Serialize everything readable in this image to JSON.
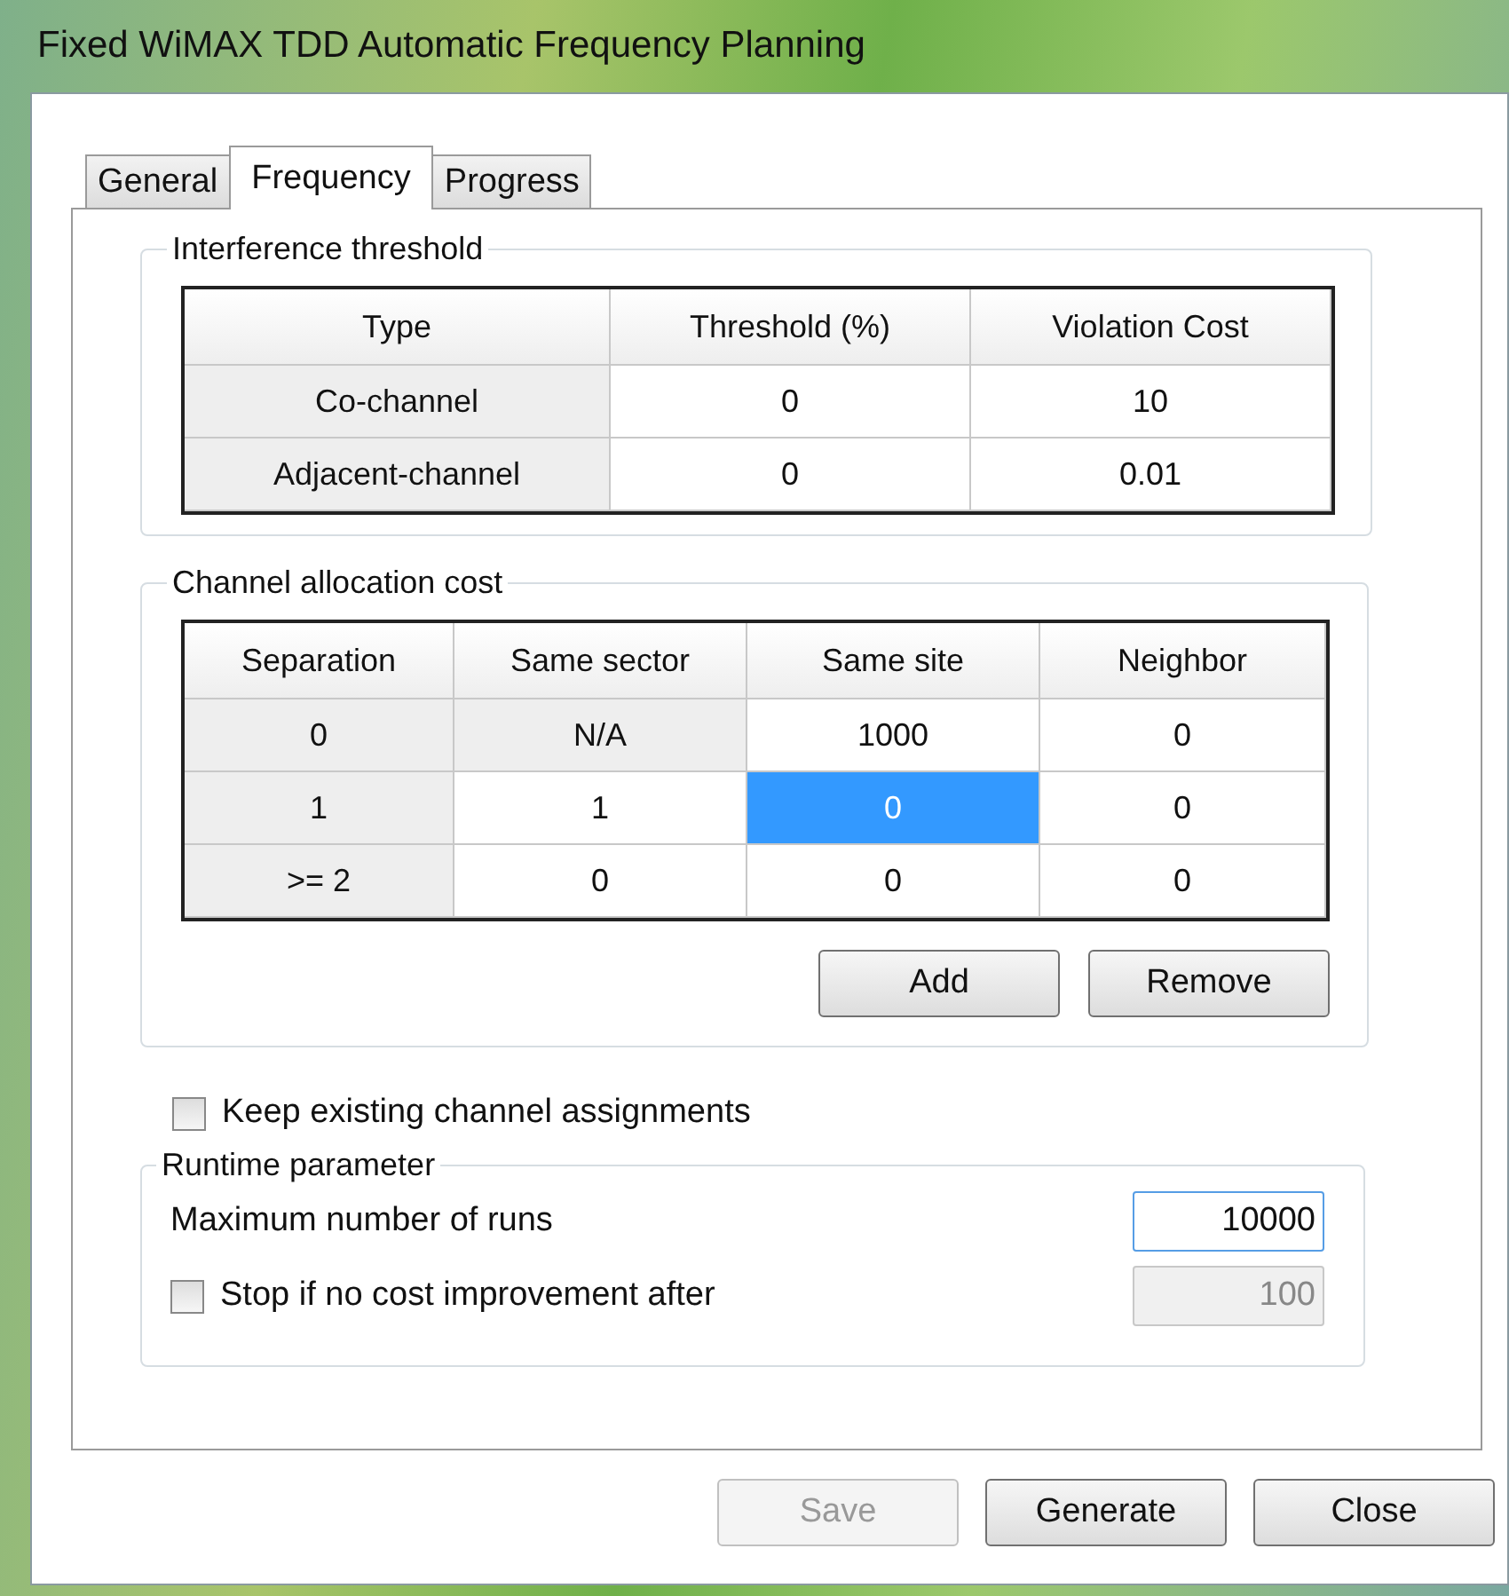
{
  "window": {
    "title": "Fixed WiMAX TDD Automatic Frequency Planning"
  },
  "tabs": [
    {
      "label": "General",
      "selected": false
    },
    {
      "label": "Frequency",
      "selected": true
    },
    {
      "label": "Progress",
      "selected": false
    }
  ],
  "interference_threshold": {
    "title": "Interference threshold",
    "columns": [
      "Type",
      "Threshold (%)",
      "Violation Cost"
    ],
    "rows": [
      [
        {
          "text": "Co-channel",
          "readonly": true,
          "selected": false
        },
        {
          "text": "0",
          "readonly": false,
          "selected": false
        },
        {
          "text": "10",
          "readonly": false,
          "selected": false
        }
      ],
      [
        {
          "text": "Adjacent-channel",
          "readonly": true,
          "selected": false
        },
        {
          "text": "0",
          "readonly": false,
          "selected": false
        },
        {
          "text": "0.01",
          "readonly": false,
          "selected": false
        }
      ]
    ]
  },
  "channel_allocation_cost": {
    "title": "Channel allocation cost",
    "columns": [
      "Separation",
      "Same sector",
      "Same site",
      "Neighbor"
    ],
    "rows": [
      [
        {
          "text": "0",
          "readonly": true,
          "selected": false
        },
        {
          "text": "N/A",
          "readonly": true,
          "selected": false
        },
        {
          "text": "1000",
          "readonly": false,
          "selected": false
        },
        {
          "text": "0",
          "readonly": false,
          "selected": false
        }
      ],
      [
        {
          "text": "1",
          "readonly": true,
          "selected": false
        },
        {
          "text": "1",
          "readonly": false,
          "selected": false
        },
        {
          "text": "0",
          "readonly": false,
          "selected": true
        },
        {
          "text": "0",
          "readonly": false,
          "selected": false
        }
      ],
      [
        {
          "text": ">= 2",
          "readonly": true,
          "selected": false
        },
        {
          "text": "0",
          "readonly": false,
          "selected": false
        },
        {
          "text": "0",
          "readonly": false,
          "selected": false
        },
        {
          "text": "0",
          "readonly": false,
          "selected": false
        }
      ]
    ],
    "buttons": [
      {
        "label": "Add",
        "disabled": false
      },
      {
        "label": "Remove",
        "disabled": false
      }
    ]
  },
  "keep_existing": {
    "label": "Keep existing channel assignments",
    "checked": false
  },
  "runtime_parameter": {
    "title": "Runtime parameter",
    "max_runs": {
      "label": "Maximum number of runs",
      "value": "10000",
      "disabled": false
    },
    "stop_if": {
      "label": "Stop if no cost improvement after",
      "checked": false,
      "value": "100",
      "disabled": true
    }
  },
  "buttons": [
    {
      "label": "Save",
      "disabled": true
    },
    {
      "label": "Generate",
      "disabled": false
    },
    {
      "label": "Close",
      "disabled": false
    }
  ]
}
